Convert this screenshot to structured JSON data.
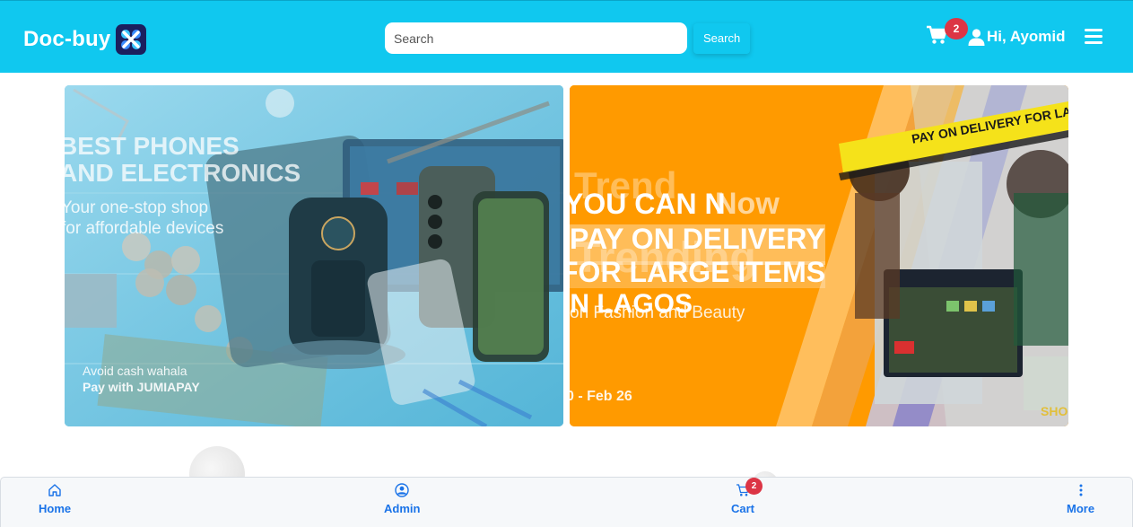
{
  "header": {
    "brand": "Doc-buy",
    "search": {
      "placeholder": "Search",
      "value": "",
      "button_label": "Search"
    },
    "cart_count": "2",
    "greeting": "Hi, Ayomid",
    "bg_color": "#10c8ef"
  },
  "banners": [
    {
      "lines": [
        "BEST PHONES",
        "AND ELECTRONICS",
        "Your one-stop shop",
        "for affordable devices",
        "Avoid cash wahala",
        "Pay with JUMIAPAY"
      ]
    },
    {
      "lines": [
        "YOU CAN N",
        "PAY ON DELIVERY",
        "FOR LARGE ITEMS",
        "IN LAGOS",
        "on Fashion and Beauty",
        "0 - Feb 26",
        "PAY ON DELIVERY FOR LARGE IT",
        "SHO",
        "Trend",
        "Now",
        "Trending"
      ]
    }
  ],
  "bottom_nav": {
    "items": [
      {
        "label": "Home",
        "icon": "home-icon"
      },
      {
        "label": "Admin",
        "icon": "user-circle-icon"
      },
      {
        "label": "Cart",
        "icon": "cart-icon",
        "badge": "2"
      },
      {
        "label": "More",
        "icon": "more-vertical-icon"
      }
    ],
    "active_color": "#1a73e8"
  }
}
